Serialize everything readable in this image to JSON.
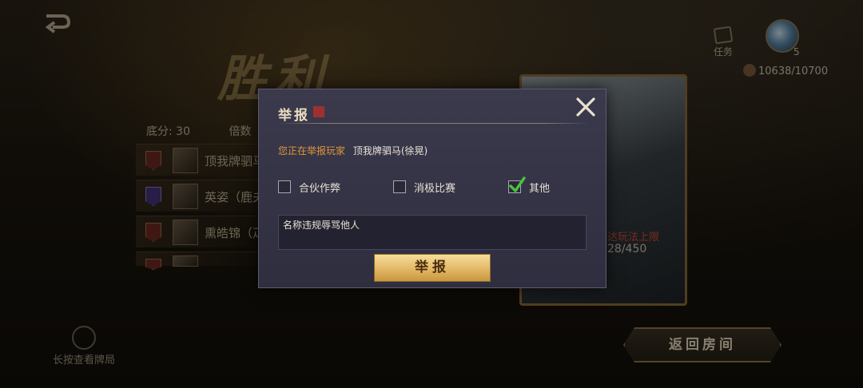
{
  "background": {
    "victory_text": "胜利",
    "score_label": "底分: 30",
    "multiplier_label": "倍数",
    "players": [
      {
        "name": "顶我牌驷马",
        "badge": "red"
      },
      {
        "name": "英姿（鹿夫",
        "badge": "purple"
      },
      {
        "name": "熏皓锦（疋",
        "badge": "red"
      },
      {
        "name": "",
        "badge": "red"
      }
    ],
    "card_limit_text": "达玩法上限",
    "card_count_text": "28/450",
    "task_label": "任务",
    "level": "5",
    "exp_text": "10638/10700",
    "long_press_label": "长按查看牌局",
    "back_room_label": "返回房间"
  },
  "dialog": {
    "title": "举报",
    "reporting_label": "您正在举报玩家",
    "reported_player": "顶我牌驷马(徐晃)",
    "options": [
      {
        "label": "合伙作弊",
        "checked": false
      },
      {
        "label": "消极比赛",
        "checked": false
      },
      {
        "label": "其他",
        "checked": true
      }
    ],
    "reason_text": "名称违规辱骂他人",
    "submit_label": "举报"
  },
  "colors": {
    "accent_orange": "#e0973a",
    "check_green": "#4cc23c",
    "button_gold": "#e2b866",
    "dialog_bg": "#3b3a4d"
  }
}
